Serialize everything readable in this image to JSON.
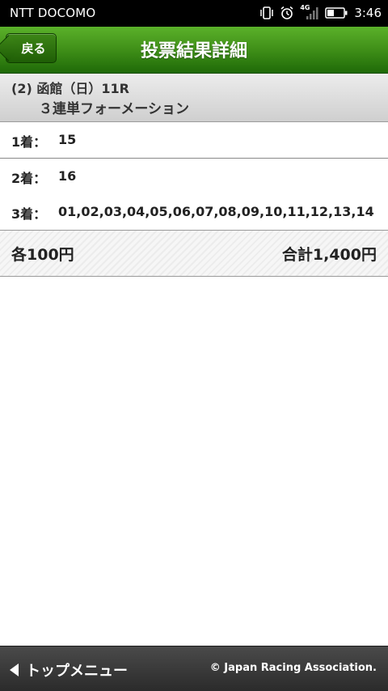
{
  "status_bar": {
    "carrier": "NTT DOCOMO",
    "network_badge": "4G",
    "time": "3:46",
    "icons": [
      "vibrate-icon",
      "alarm-icon",
      "signal-icon",
      "battery-icon"
    ]
  },
  "header": {
    "back_label": "戻る",
    "title": "投票結果詳細",
    "color_top": "#5bb12a",
    "color_bottom": "#1f6a08"
  },
  "race": {
    "line1": "(2) 函館（日）11R",
    "line2": "３連単フォーメーション"
  },
  "picks": [
    {
      "label": "1着：",
      "value": "15"
    },
    {
      "label": "2着：",
      "value": "16"
    },
    {
      "label": "3着：",
      "value": "01,02,03,04,05,06,07,08,09,10,11,12,13,14"
    }
  ],
  "totals": {
    "each": "各100円",
    "total": "合計1,400円"
  },
  "footer": {
    "top_menu_label": "トップメニュー",
    "copyright": "© Japan Racing Association."
  }
}
